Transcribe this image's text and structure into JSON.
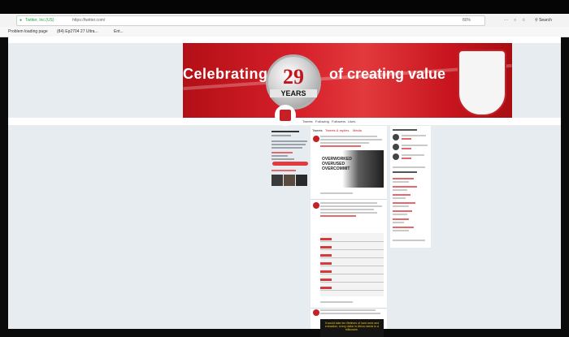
{
  "browser": {
    "tab_url": "https://twitter.com/",
    "site_label": "Twitter, Inc.(US)",
    "zoom": "80%",
    "search_placeholder": "Search"
  },
  "bookmarks": [
    {
      "label": "Problem loading page"
    },
    {
      "label": "(84) Ep2704 27 Ultra..."
    },
    {
      "label": "Ent..."
    }
  ],
  "banner": {
    "text_left": "Celebrating",
    "number": "29",
    "years": "YEARS",
    "text_right": "of creating value"
  },
  "profile_tabs": [
    "Tweets",
    "Following",
    "Followers",
    "Likes"
  ],
  "timeline_tabs": [
    "Tweets",
    "Tweets & replies",
    "Media"
  ],
  "tweet_image_text": "OVERWORKED OVERUSED OVERCOMMIT",
  "tweet2_image_text": "It would take ten lifetimes of hard work and extraction, every dollar in Africa needs to a billionaire.",
  "colors": {
    "brand": "#c62026",
    "background": "#e7ecf0"
  }
}
